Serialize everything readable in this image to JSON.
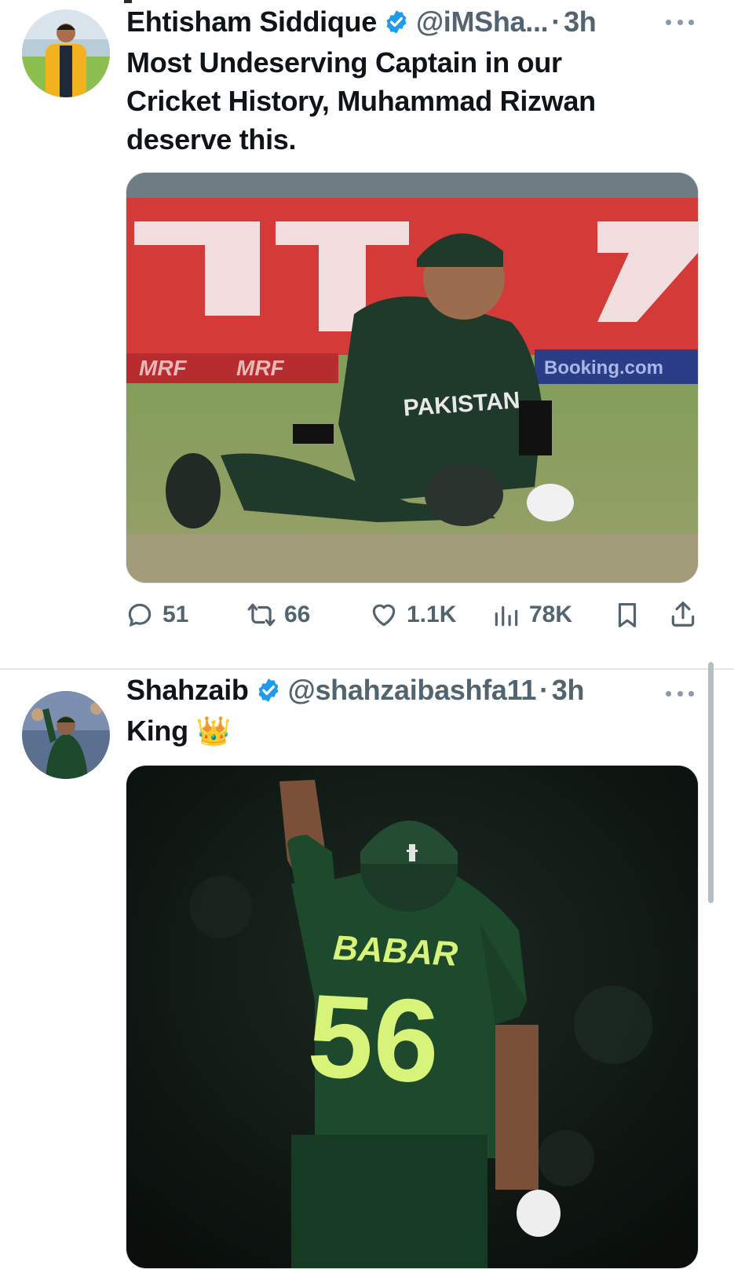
{
  "colors": {
    "accent": "#1d9bf0",
    "muted": "#536471",
    "text": "#0f1419"
  },
  "tweets": [
    {
      "author": "Ehtisham Siddique",
      "handle": "@iMSha...",
      "separator": "·",
      "time": "3h",
      "text": "Most Undeserving Captain in our\nCricket History, Muhammad Rizwan\ndeserve this.",
      "media_text": {
        "jersey": "PAKISTAN",
        "board_left": "MRF",
        "board_right": "Booking.com"
      },
      "stats": {
        "replies": "51",
        "reposts": "66",
        "likes": "1.1K",
        "views": "78K"
      }
    },
    {
      "author": "Shahzaib",
      "handle": "@shahzaibashfa11",
      "separator": "·",
      "time": "3h",
      "text": "King 👑",
      "media_text": {
        "jersey_name": "BABAR",
        "jersey_number": "56"
      }
    }
  ]
}
